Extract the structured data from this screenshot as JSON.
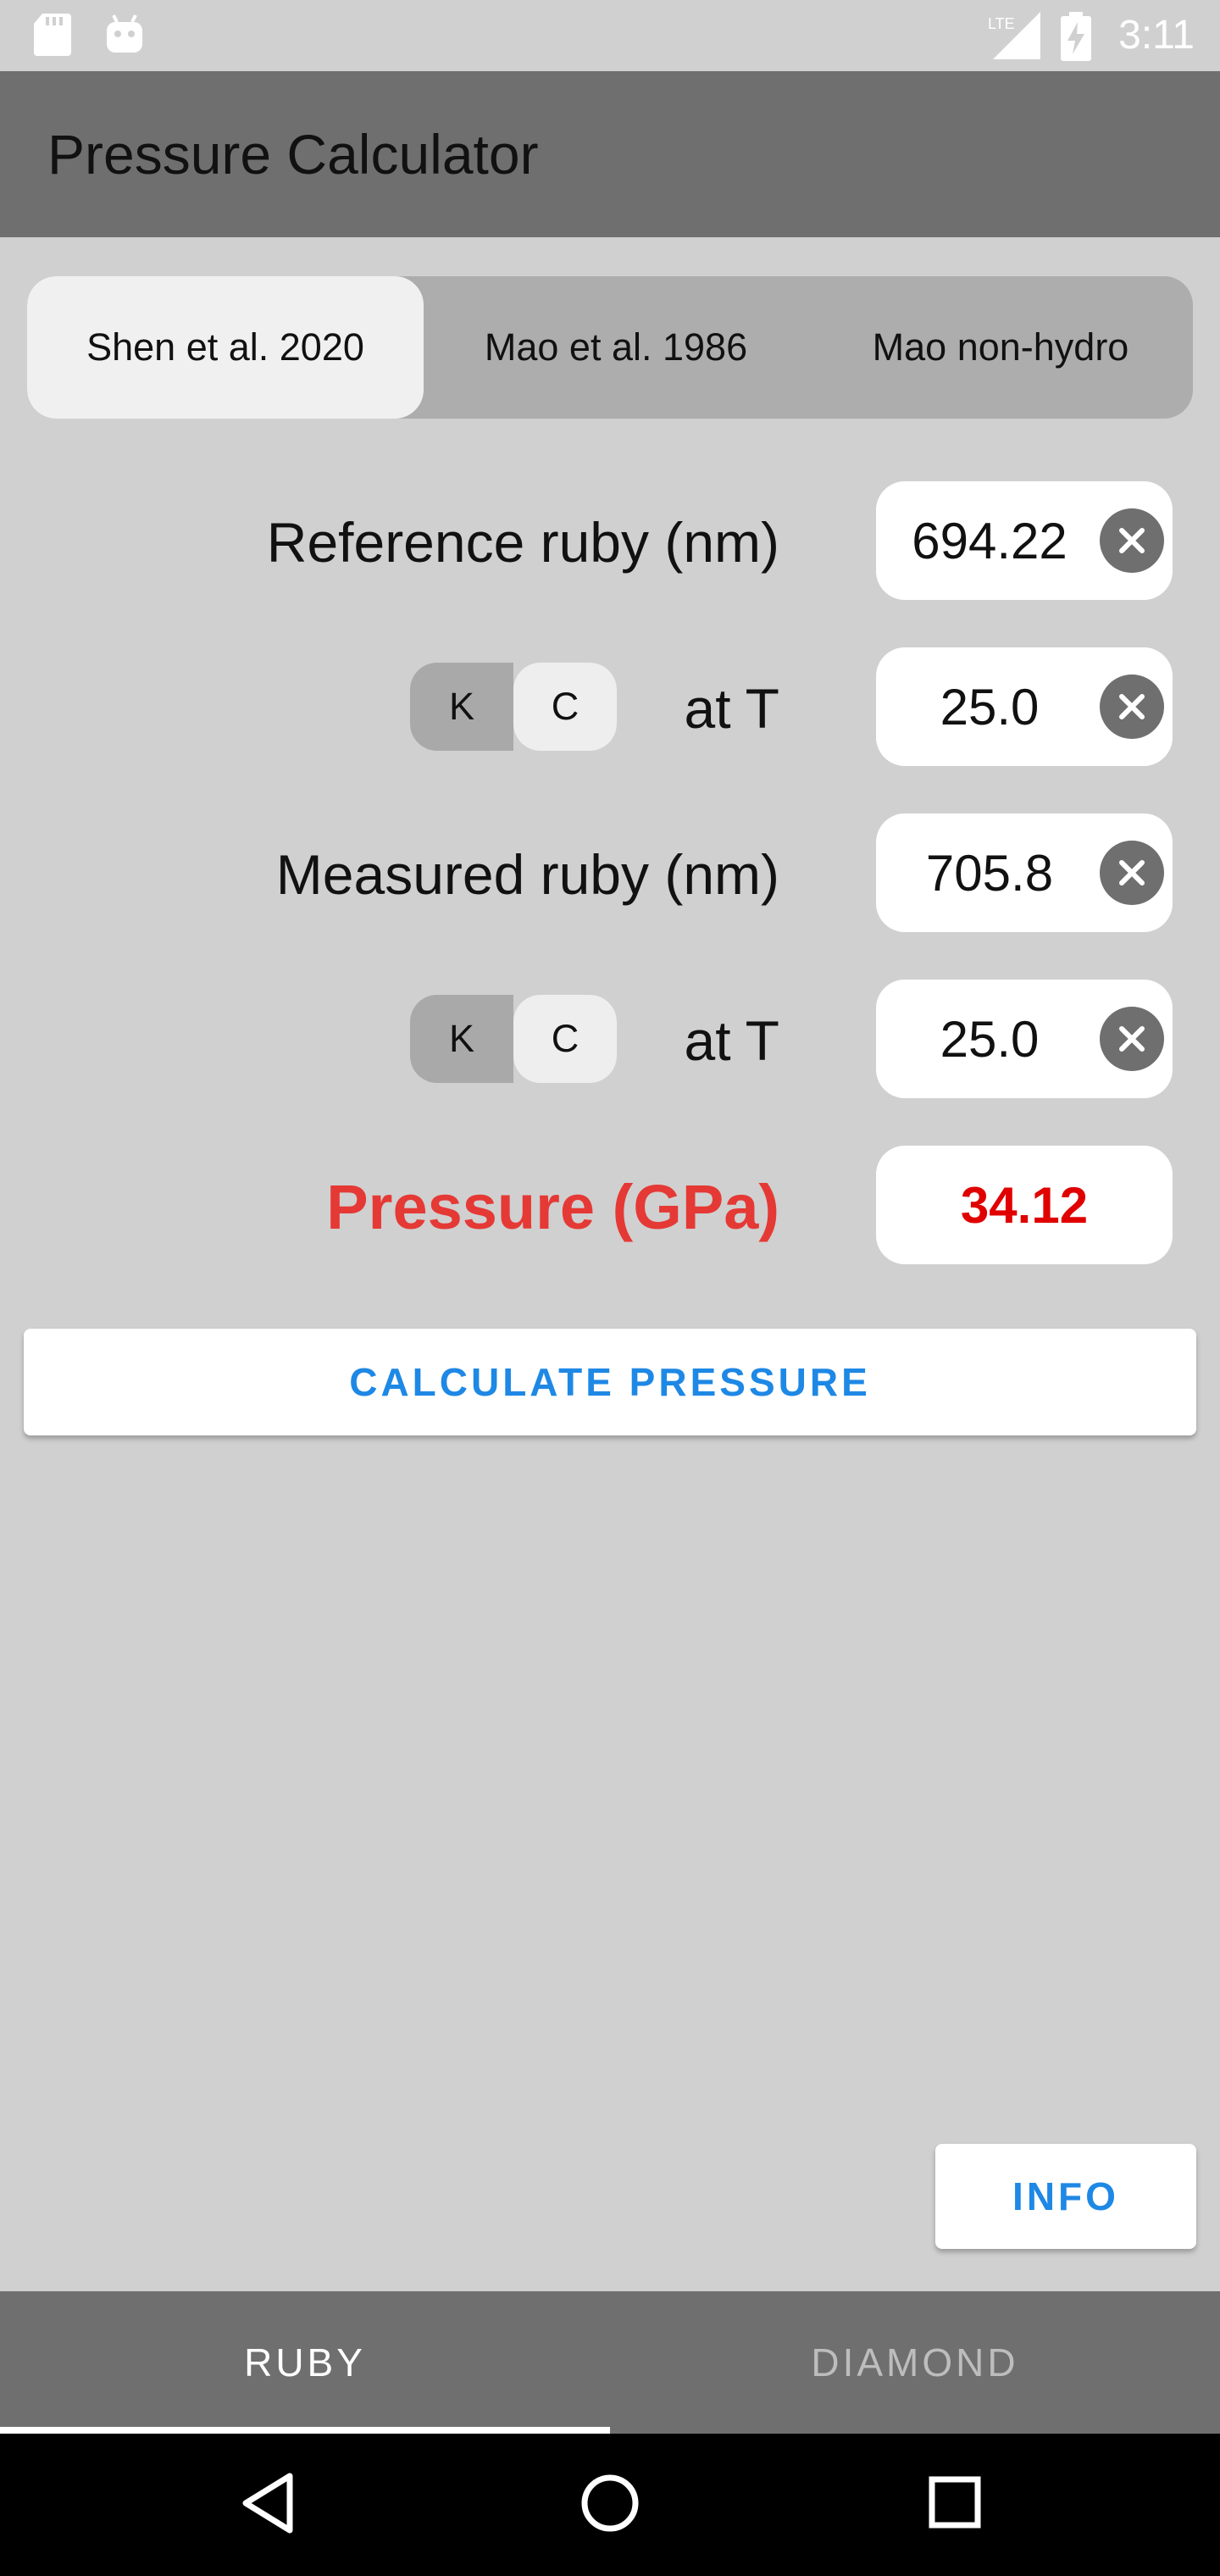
{
  "status_bar": {
    "time": "3:11",
    "network": "LTE",
    "icons": [
      "sd-card-icon",
      "android-icon",
      "lte-signal-icon",
      "battery-charging-icon"
    ]
  },
  "app_bar": {
    "title": "Pressure Calculator"
  },
  "calibration_tabs": [
    {
      "label": "Shen et al. 2020",
      "selected": true
    },
    {
      "label": "Mao et al. 1986",
      "selected": false
    },
    {
      "label": "Mao non-hydro",
      "selected": false
    }
  ],
  "reference": {
    "label": "Reference ruby (nm)",
    "value": "694.22",
    "temp_label": "at T",
    "temp_value": "25.0",
    "unit_options": [
      "K",
      "C"
    ]
  },
  "measured": {
    "label": "Measured ruby (nm)",
    "value": "705.8",
    "temp_label": "at T",
    "temp_value": "25.0",
    "unit_options": [
      "K",
      "C"
    ]
  },
  "result": {
    "label": "Pressure (GPa)",
    "value": "34.12"
  },
  "buttons": {
    "calculate": "CALCULATE PRESSURE",
    "info": "INFO"
  },
  "bottom_tabs": [
    {
      "label": "RUBY",
      "selected": true
    },
    {
      "label": "DIAMOND",
      "selected": false
    }
  ],
  "colors": {
    "accent": "#1e88e5",
    "pressure": "#e53935",
    "app_bar": "#6f6f6f",
    "background": "#d0d0d0"
  }
}
